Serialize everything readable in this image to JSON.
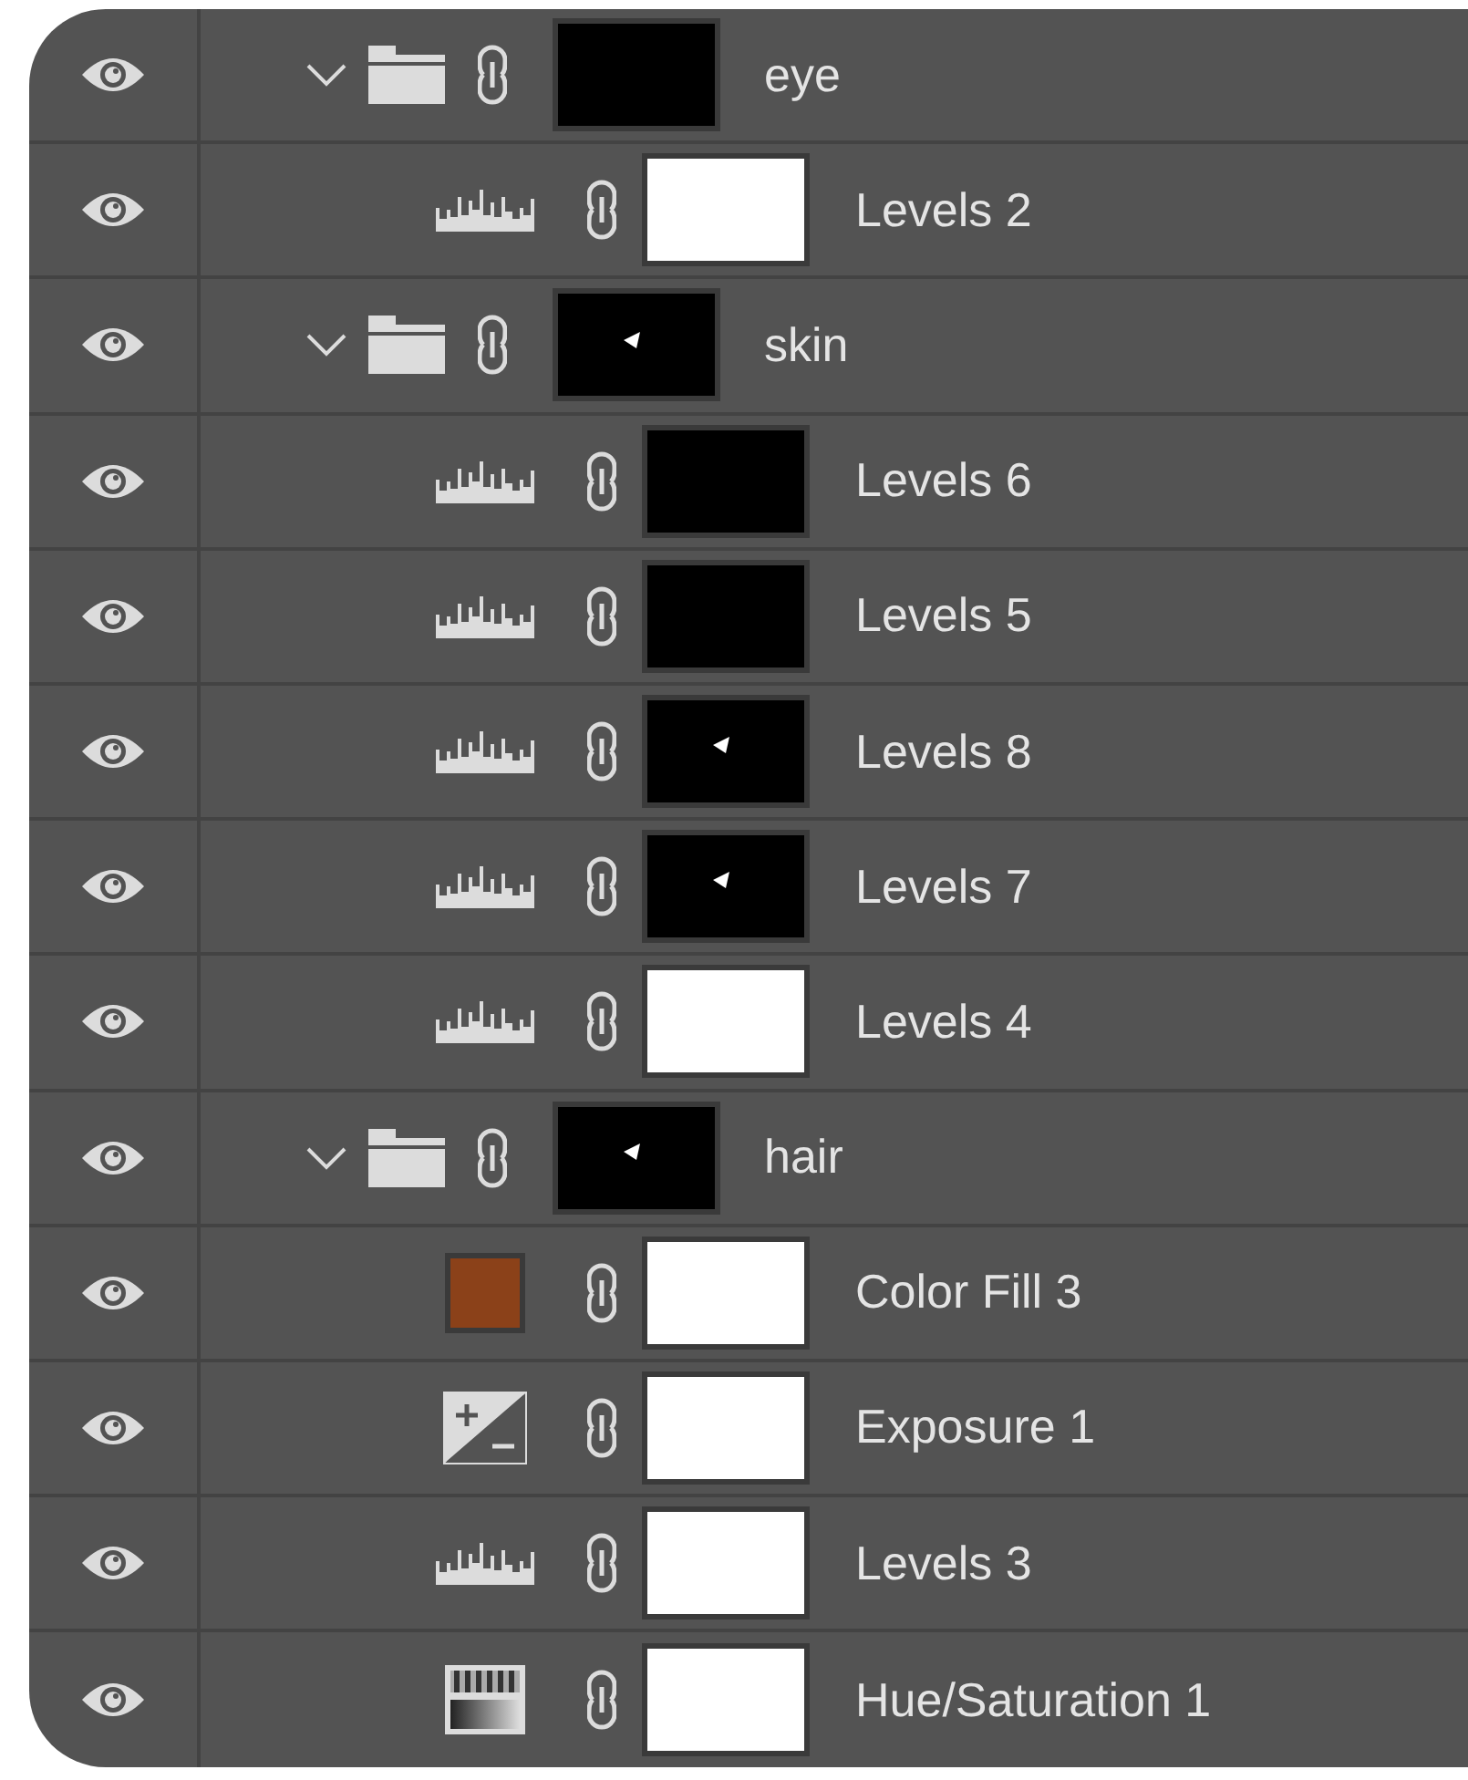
{
  "layers": [
    {
      "kind": "group",
      "name": "eye",
      "visible": true,
      "expanded": true,
      "mask_dark": true,
      "mask_speck": false,
      "children": [
        {
          "kind": "levels",
          "name": "Levels 2",
          "visible": true,
          "mask_dark": false,
          "mask_speck": false
        }
      ]
    },
    {
      "kind": "group",
      "name": "skin",
      "visible": true,
      "expanded": true,
      "mask_dark": true,
      "mask_speck": true,
      "children": [
        {
          "kind": "levels",
          "name": "Levels 6",
          "visible": true,
          "mask_dark": true,
          "mask_speck": false
        },
        {
          "kind": "levels",
          "name": "Levels 5",
          "visible": true,
          "mask_dark": true,
          "mask_speck": false
        },
        {
          "kind": "levels",
          "name": "Levels 8",
          "visible": true,
          "mask_dark": true,
          "mask_speck": true
        },
        {
          "kind": "levels",
          "name": "Levels 7",
          "visible": true,
          "mask_dark": true,
          "mask_speck": true
        },
        {
          "kind": "levels",
          "name": "Levels 4",
          "visible": true,
          "mask_dark": false,
          "mask_speck": false
        }
      ]
    },
    {
      "kind": "group",
      "name": "hair",
      "visible": true,
      "expanded": true,
      "mask_dark": true,
      "mask_speck": true,
      "children": [
        {
          "kind": "color_fill",
          "name": "Color Fill 3",
          "visible": true,
          "color": "#8b4119",
          "mask_dark": false,
          "mask_speck": false
        },
        {
          "kind": "exposure",
          "name": "Exposure 1",
          "visible": true,
          "mask_dark": false,
          "mask_speck": false
        },
        {
          "kind": "levels",
          "name": "Levels 3",
          "visible": true,
          "mask_dark": false,
          "mask_speck": false
        },
        {
          "kind": "hue_saturation",
          "name": "Hue/Saturation 1",
          "visible": true,
          "mask_dark": false,
          "mask_speck": false
        }
      ]
    }
  ]
}
